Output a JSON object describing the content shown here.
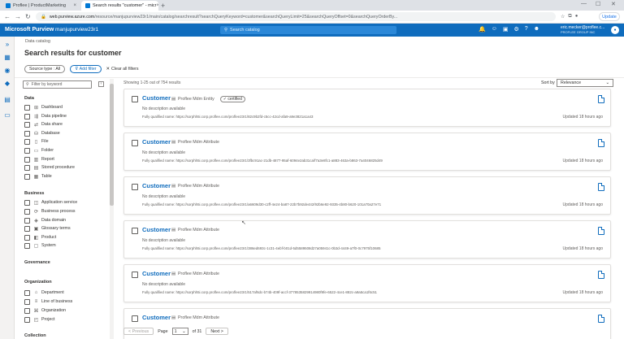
{
  "browser": {
    "tabs": [
      {
        "label": "Proflee | ProductMarketing",
        "active": false
      },
      {
        "label": "Search results \"customer\" - micr",
        "active": true
      }
    ],
    "url_host": "web.purview.azure.com",
    "url_path": "/resource/manjupurview23r1/main/catalog/searchresult?searchQueryKeyword=customer&searchQueryLimit=25&searchQueryOffset=0&searchQueryOrderBy...",
    "update_label": "Update"
  },
  "header": {
    "brand": "Microsoft Purview",
    "account": "manjupurview23r1",
    "search_placeholder": "Search catalog",
    "user_name": "eric.mecker@proflee.c...",
    "user_org": "PROFLEE GROUP INC"
  },
  "main": {
    "breadcrumb": "Data catalog",
    "title": "Search results for customer",
    "source_type": "Source type : All",
    "add_filter": "Add filter",
    "clear_filters": "Clear all filters",
    "filter_placeholder": "Filter by keyword",
    "showing": "Showing 1-25 out of 754 results",
    "sort_label": "Sort by",
    "sort_value": "Relevance"
  },
  "filters": {
    "data": {
      "title": "Data",
      "items": [
        "Dashboard",
        "Data pipeline",
        "Data share",
        "Database",
        "File",
        "Folder",
        "Report",
        "Stored procedure",
        "Table"
      ]
    },
    "business": {
      "title": "Business",
      "items": [
        "Application service",
        "Business process",
        "Data domain",
        "Glossary terms",
        "Product",
        "System"
      ]
    },
    "governance": {
      "title": "Governance"
    },
    "organization": {
      "title": "Organization",
      "items": [
        "Department",
        "Line of business",
        "Organization",
        "Project"
      ]
    },
    "collection": {
      "title": "Collection"
    }
  },
  "results": [
    {
      "title": "Customer",
      "type": "Proflee Mdm Entity",
      "badge": "certified",
      "desc": "No description available",
      "qn": "Fully qualified name: https://sorphh5i.corp.proflee.com/proflee23r1/82c9b2fd-c5cc-42cd-afa9-a9e3821a1a43",
      "updated": "Updated 18 hours ago"
    },
    {
      "title": "Customer",
      "type": "Proflee Mdm Attribute",
      "badge": "",
      "desc": "No description available",
      "qn": "Fully qualified name: https://sorphh5i.corp.proflee.com/proflee23r1/3fbc91ac-21db-4877-95af-6094e2ab31ca/f7a3e8fc1-a883-463a-b863-7a4046825d49",
      "updated": "Updated 18 hours ago"
    },
    {
      "title": "Customer",
      "type": "Proflee Mdm Attribute",
      "badge": "",
      "desc": "No description available",
      "qn": "Fully qualified name: https://sorphh5i.corp.proflee.com/proflee23r1/a6609d30-c2ff-4e24-ba87-22b7b92de442/92b6e92-9335-4b80-b620-101a70a27e71",
      "updated": "Updated 18 hours ago"
    },
    {
      "title": "Customer",
      "type": "Proflee Mdm Attribute",
      "badge": "",
      "desc": "No description available",
      "qn": "Fully qualified name: https://sorphh5i.corp.proflee.com/proflee23r1/386ed693c-1c31-4ebf-b01d-5d5589508d27a05941c-0b3d-4449-a7f0-0c7975f10685",
      "updated": "Updated 18 hours ago"
    },
    {
      "title": "Customer",
      "type": "Proflee Mdm Attribute",
      "badge": "",
      "desc": "No description available",
      "qn": "Fully qualified name: https://sorphh5i.corp.proflee.com/proflee23r1/517af6dc-b74b-409f-accf-3778535829914980f9fe-6522-4ce1-882c-a9a5ca1f6c51",
      "updated": "Updated 18 hours ago"
    },
    {
      "title": "Customer",
      "type": "Proflee Mdm Attribute",
      "badge": "",
      "desc": "",
      "qn": "",
      "updated": ""
    }
  ],
  "pager": {
    "prev": "< Previous",
    "page_label": "Page",
    "page_value": "1",
    "of": "of 31",
    "next": "Next >"
  }
}
